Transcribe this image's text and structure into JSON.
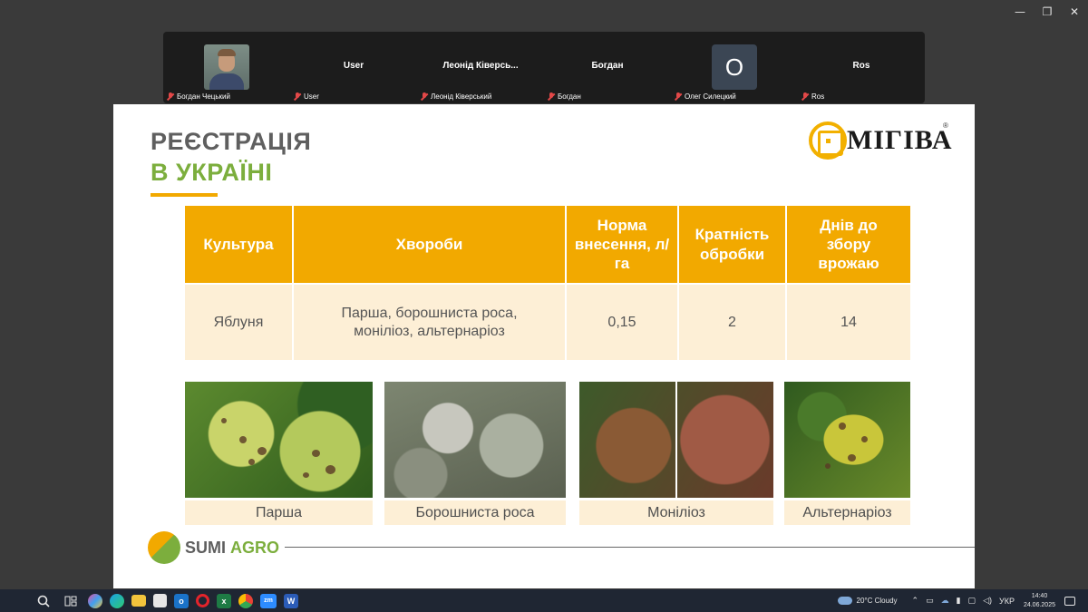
{
  "window": {
    "minimize": "—",
    "restore": "❐",
    "close": "✕"
  },
  "participants": [
    {
      "tile_text": "",
      "label": "Богдан Чецький",
      "avatar": "photo"
    },
    {
      "tile_text": "User",
      "label": "User",
      "avatar": "name"
    },
    {
      "tile_text": "Леонід Ківерсь...",
      "label": "Леонід Ківерський",
      "avatar": "name"
    },
    {
      "tile_text": "Богдан",
      "label": "Богдан",
      "avatar": "name"
    },
    {
      "tile_text": "О",
      "label": "Олег Силецкий",
      "avatar": "letter"
    },
    {
      "tile_text": "Ros",
      "label": "Ros",
      "avatar": "name"
    }
  ],
  "slide": {
    "title_line1": "РЕЄСТРАЦІЯ",
    "title_line2": "В УКРАЇНІ",
    "logo_text": "МІГІВА",
    "logo_reg": "®",
    "table": {
      "headers": [
        "Культура",
        "Хвороби",
        "Норма внесення, л/га",
        "Кратність обробки",
        "Днів до збору врожаю"
      ],
      "rows": [
        [
          "Яблуня",
          "Парша, борошниста роса, моніліоз, альтернаріоз",
          "0,15",
          "2",
          "14"
        ]
      ]
    },
    "photos": [
      {
        "label": "Парша"
      },
      {
        "label": "Борошниста роса"
      },
      {
        "label": "Моніліоз"
      },
      {
        "label": "Альтернаріоз"
      }
    ],
    "footer_logo_part1": "SUMI",
    "footer_logo_part2": "AGRO"
  },
  "taskbar": {
    "apps": [
      "start-icon",
      "search-icon",
      "task-view-icon",
      "copilot-icon",
      "edge-icon",
      "file-explorer-icon",
      "store-icon",
      "outlook-icon",
      "opera-icon",
      "excel-icon",
      "chrome-icon",
      "zoom-icon",
      "word-icon"
    ],
    "weather": "20°C  Cloudy",
    "language": "УКР",
    "time": "14:40",
    "date": "24.06.2025"
  },
  "colors": {
    "accent_orange": "#f2a900",
    "accent_green": "#7cae3d",
    "table_row_bg": "#fdefd6"
  }
}
